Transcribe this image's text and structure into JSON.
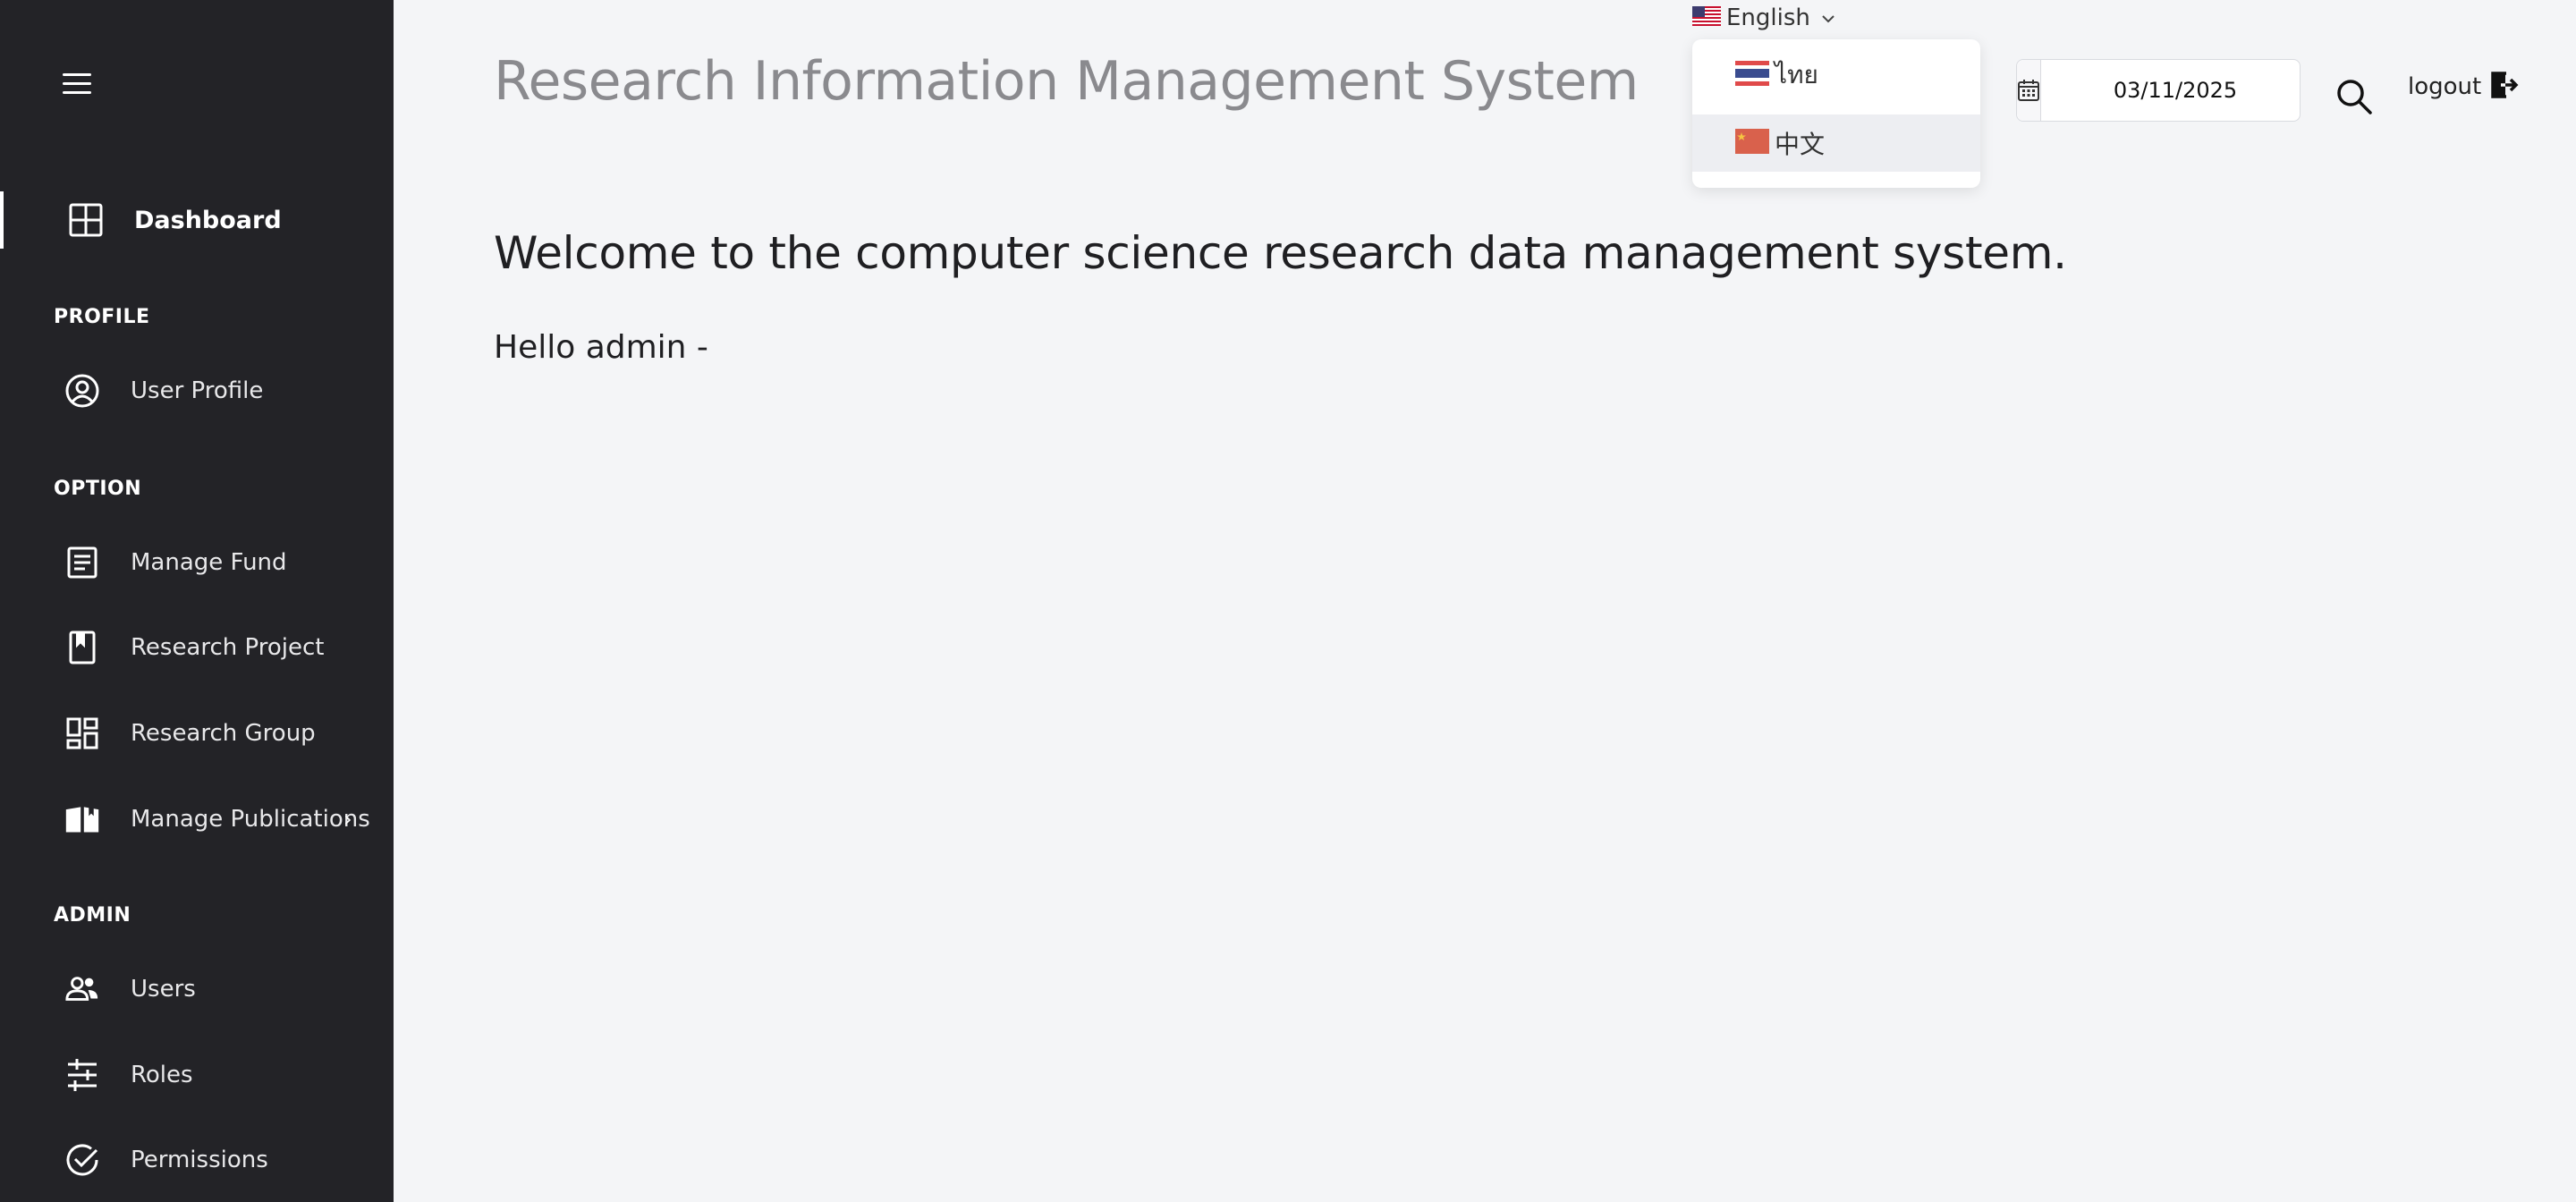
{
  "header": {
    "app_title": "Research Information Management System",
    "language": {
      "selected": "English",
      "options": [
        {
          "label": "ไทย",
          "flag": "thailand-flag-icon"
        },
        {
          "label": "中文",
          "flag": "china-flag-icon"
        }
      ]
    },
    "date": "03/11/2025",
    "logout_label": "logout"
  },
  "sidebar": {
    "dashboard": "Dashboard",
    "sections": {
      "profile": "PROFILE",
      "option": "OPTION",
      "admin": "ADMIN"
    },
    "items": {
      "user_profile": "User Profile",
      "manage_fund": "Manage Fund",
      "research_project": "Research Project",
      "research_group": "Research Group",
      "manage_publications": "Manage Publications",
      "users": "Users",
      "roles": "Roles",
      "permissions": "Permissions"
    }
  },
  "main": {
    "welcome": "Welcome to the computer science research data management system.",
    "hello": "Hello admin -"
  },
  "colors": {
    "sidebar_bg": "#232327",
    "page_bg": "#f4f5f7",
    "title_gray": "#8a8a8e"
  }
}
